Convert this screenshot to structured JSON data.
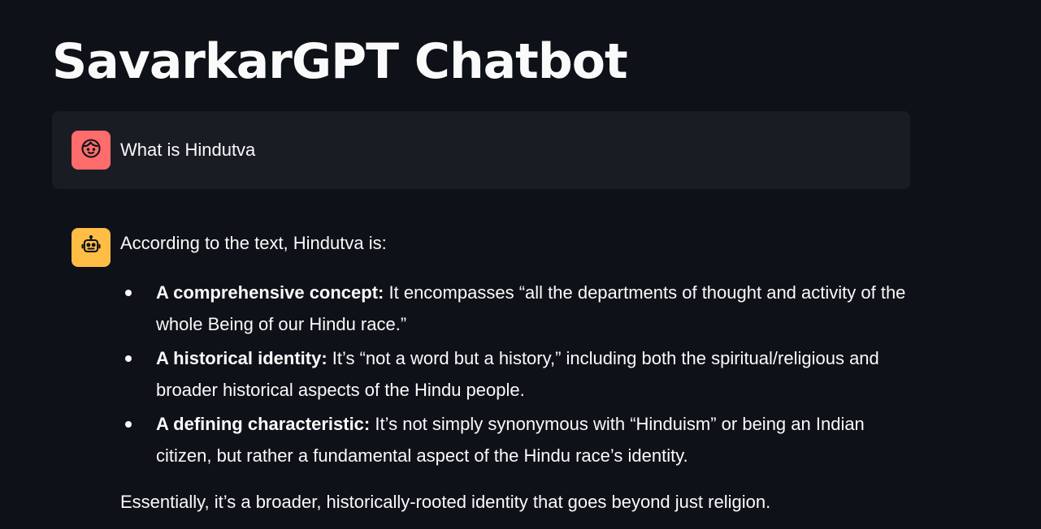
{
  "app": {
    "title": "SavarkarGPT Chatbot"
  },
  "colors": {
    "background": "#0e1117",
    "user_bubble": "#1a1c24",
    "user_avatar": "#ff6c6c",
    "assistant_avatar": "#ffbd45",
    "text": "#fafafa"
  },
  "messages": [
    {
      "role": "user",
      "avatar_icon": "face-icon",
      "text": "What is Hindutva"
    },
    {
      "role": "assistant",
      "avatar_icon": "robot-icon",
      "intro": "According to the text, Hindutva is:",
      "bullets": [
        {
          "label": "A comprehensive concept:",
          "text": "It encompasses “all the departments of thought and activity of the whole Being of our Hindu race.”"
        },
        {
          "label": "A historical identity:",
          "text": "It’s “not a word but a history,” including both the spiritual/religious and broader historical aspects of the Hindu people."
        },
        {
          "label": "A defining characteristic:",
          "text": "It’s not simply synonymous with “Hinduism” or being an Indian citizen, but rather a fundamental aspect of the Hindu race’s identity."
        }
      ],
      "closing": "Essentially, it’s a broader, historically-rooted identity that goes beyond just religion."
    }
  ]
}
